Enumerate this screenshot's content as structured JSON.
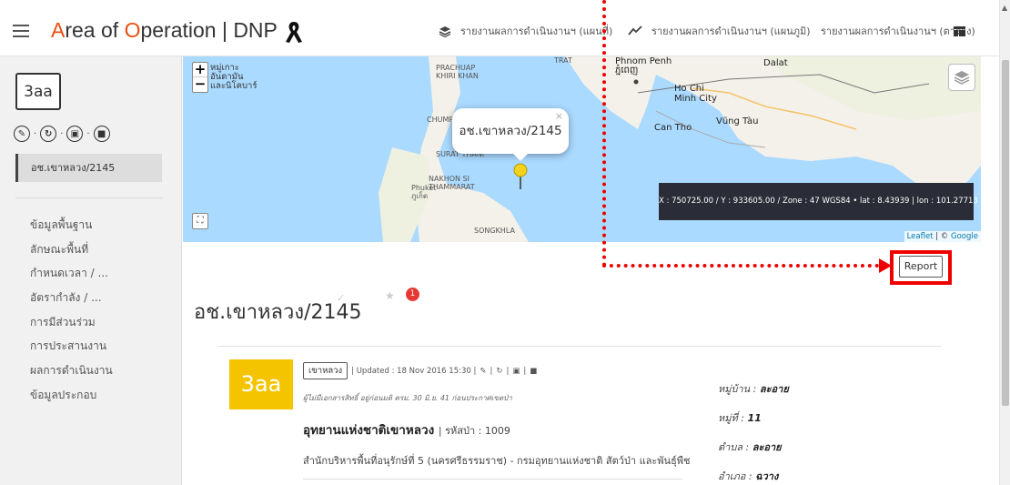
{
  "header": {
    "app_title_parts": [
      "A",
      "rea of ",
      "O",
      "peration | DNP"
    ],
    "nav": [
      {
        "label": "รายงานผลการดำเนินงานฯ (แผนที่)",
        "icon": "layers-icon"
      },
      {
        "label": "รายงานผลการดำเนินงานฯ (แผนภูมิ)",
        "icon": "line-chart-icon"
      },
      {
        "label": "รายงานผลการดำเนินงานฯ (ตาราง)",
        "icon": "grid-icon"
      }
    ]
  },
  "sidebar": {
    "avatar": "3aa",
    "active_item": "อช.เขาหลวง/2145",
    "menu": [
      "ข้อมูลพื้นฐาน",
      "ลักษณะพื้นที่",
      "กำหนดเวลา / ...",
      "อัตรากำลัง / ...",
      "การมีส่วนร่วม",
      "การประสานงาน",
      "ผลการดำเนินงาน",
      "ข้อมูลประกอบ"
    ]
  },
  "map": {
    "zoom_in": "+",
    "zoom_out": "−",
    "popup_label": "อช.เขาหลวง/2145",
    "coordinates": "X : 750725.00 / Y : 933605.00 / Zone : 47 WGS84 • lat : 8.43939 | lon : 101.27713",
    "attribution_leaflet": "Leaflet",
    "attribution_sep": " | © ",
    "attribution_google": "Google",
    "labels": {
      "prachuap": "PRACHUAP\nKHIRI KHAN",
      "chumphon": "CHUMPHON",
      "surat": "SURAT THANI",
      "nakhon": "NAKHON SI\nTHAMMARAT",
      "phuket": "Phuket\nภูเก็ต",
      "songkhla": "SONGKHLA",
      "trat": "TRAT",
      "phnom_penh": "Phnom Penh\nភ្នំពេញ",
      "hochiminh": "Ho Chi\nMinh City",
      "cantho": "Can Tho",
      "vungtau": "Vũng Tàu",
      "dalat": "Dalat",
      "thai_top": "หมู่เกาะ\nอันดามัน\nและนิโคบาร์"
    }
  },
  "report_button": "Report",
  "page_title": "อช.เขาหลวง/2145",
  "badge_count": "1",
  "card": {
    "code": "3aa",
    "tag": "เขาหลวง",
    "updated": "| Updated : 18 Nov 2016 15:30 |",
    "note": "ผู้ไม่มีเอกสารสิทธิ์ อยู่ก่อนมติ ครม. 30 มิ.ย. 41 ก่อนประกาศเขตป่า",
    "park_name": "อุทยานแห่งชาติเขาหลวง",
    "park_code": "| รหัสป่า : 1009",
    "office": "สำนักบริหารพื้นที่อนุรักษ์ที่ 5 (นครศรีธรรมราช) - กรมอุทยานแห่งชาติ สัตว์ป่า และพันธุ์พืช",
    "address": [
      {
        "key": "หมู่บ้าน :",
        "value": "ละอาย"
      },
      {
        "key": "หมู่ที่ :",
        "value": "11"
      },
      {
        "key": "ตำบล :",
        "value": "ละอาย"
      },
      {
        "key": "อำเภอ :",
        "value": "ฉวาง"
      }
    ]
  },
  "colors": {
    "accent_orange": "#e8500e",
    "annotation_red": "#e00000",
    "code_yellow": "#f5c400",
    "badge_red": "#e53935"
  }
}
